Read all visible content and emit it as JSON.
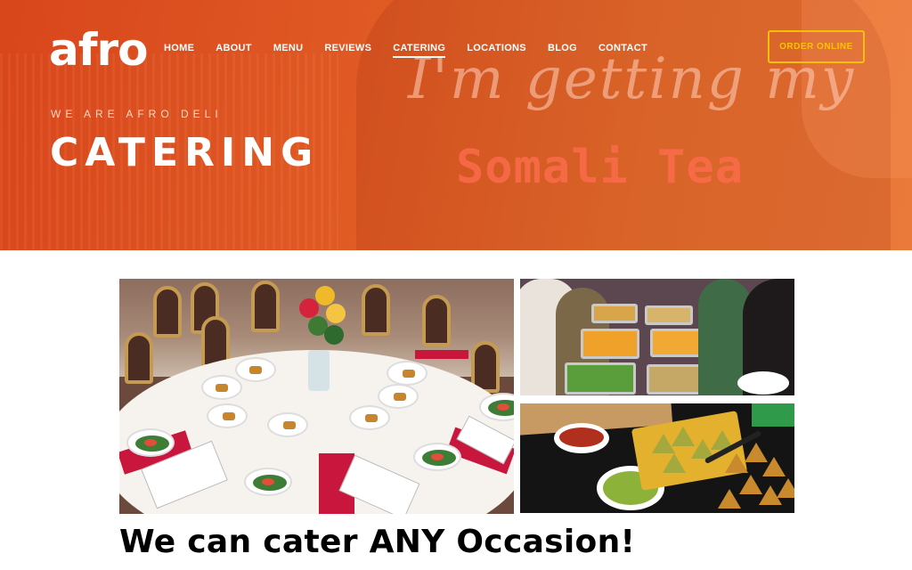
{
  "brand": {
    "logo_text": "afro"
  },
  "nav": {
    "items": [
      {
        "label": "HOME",
        "active": false
      },
      {
        "label": "ABOUT",
        "active": false
      },
      {
        "label": "MENU",
        "active": false
      },
      {
        "label": "REVIEWS",
        "active": false
      },
      {
        "label": "CATERING",
        "active": true
      },
      {
        "label": "LOCATIONS",
        "active": false
      },
      {
        "label": "BLOG",
        "active": false
      },
      {
        "label": "CONTACT",
        "active": false
      }
    ],
    "cta_label": "ORDER ONLINE"
  },
  "hero": {
    "eyebrow": "WE ARE AFRO DELI",
    "title": "CATERING",
    "background_script_text": "I'm getting my",
    "background_led_text": "Somali  Tea"
  },
  "gallery": {
    "photos": [
      {
        "name": "banquet-table-photo"
      },
      {
        "name": "buffet-line-photo"
      },
      {
        "name": "samosa-platter-photo"
      }
    ]
  },
  "content": {
    "headline": "We can cater ANY Occasion!"
  },
  "colors": {
    "hero_orange": "#e05a24",
    "cta_yellow": "#ffc107",
    "text_white": "#ffffff",
    "headline_black": "#000000"
  }
}
